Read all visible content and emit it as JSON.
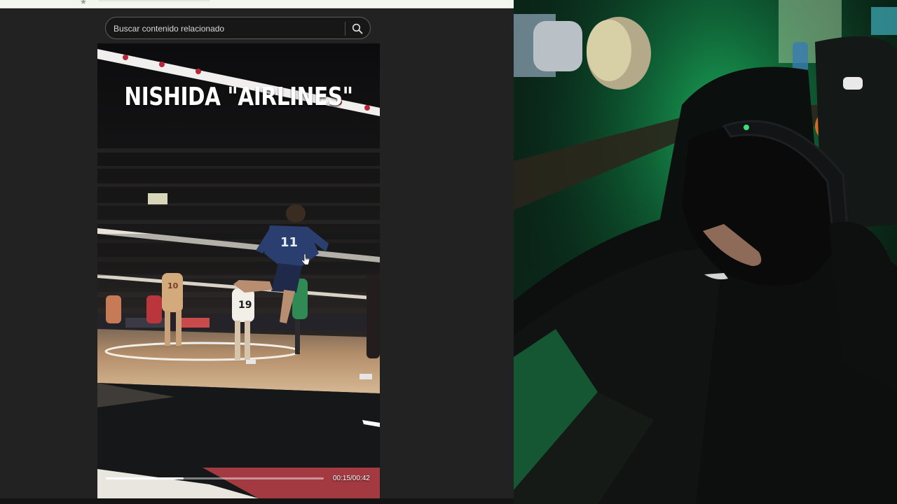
{
  "search": {
    "placeholder": "Buscar contenido relacionado",
    "button_icon": "search-icon"
  },
  "video": {
    "caption": "NISHIDA \"AIRLINES\"",
    "time": "00:15/00:42",
    "progress": 0.357,
    "jersey_numbers": [
      "11",
      "10",
      "19"
    ]
  },
  "webcam": {
    "icons": [
      "microphone-icon",
      "headphones-icon",
      "gaming-chair-icon"
    ]
  },
  "colors": {
    "page_background": "#222222",
    "search_border": "#5c5c5c",
    "webcam_glow": "#1fd870",
    "court_floor": "#b48e6a"
  }
}
